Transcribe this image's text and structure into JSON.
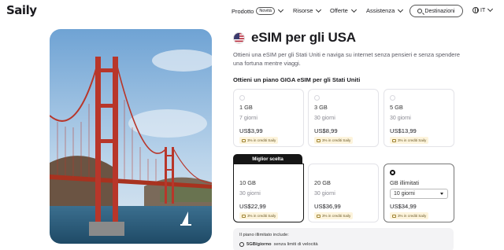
{
  "nav": {
    "logo": "Saily",
    "products_label": "Prodotto",
    "new_badge": "Novità",
    "resources_label": "Risorse",
    "offers_label": "Offerte",
    "support_label": "Assistenza",
    "destinations_label": "Destinazioni",
    "language_label": "IT"
  },
  "hero": {
    "image_icon": "golden-gate-bridge-photo"
  },
  "page": {
    "title": "eSIM per gli USA",
    "subtitle": "Ottieni una eSIM per gli Stati Uniti e naviga su internet senza pensieri e senza spendere una fortuna mentre viaggi.",
    "plans_heading": "Ottieni un piano GIGA eSIM per gli Stati Uniti"
  },
  "plans": [
    {
      "gb": "1 GB",
      "days": "7 giorni",
      "price": "US$3,99",
      "credit": "3% in crediti Saily"
    },
    {
      "gb": "3 GB",
      "days": "30 giorni",
      "price": "US$8,99",
      "credit": "3% in crediti Saily"
    },
    {
      "gb": "5 GB",
      "days": "30 giorni",
      "price": "US$13,99",
      "credit": "3% in crediti Saily"
    },
    {
      "gb": "10 GB",
      "days": "30 giorni",
      "price": "US$22,99",
      "credit": "3% in crediti Saily"
    },
    {
      "gb": "20 GB",
      "days": "30 giorni",
      "price": "US$36,99",
      "credit": "3% in crediti Saily"
    },
    {
      "gb": "GB illimitati",
      "days": "10 giorni",
      "price": "US$34,99",
      "credit": "3% in crediti Saily"
    }
  ],
  "best_choice_label": "Miglior scelta",
  "info": {
    "title": "Il piano illimitato include:",
    "line_bold": "5GB/giorno",
    "line_rest": "senza limiti di velocità"
  },
  "colors": {
    "dark": "#161616",
    "credit_bg": "#fdf4dc",
    "bridge": "#c0392b"
  }
}
